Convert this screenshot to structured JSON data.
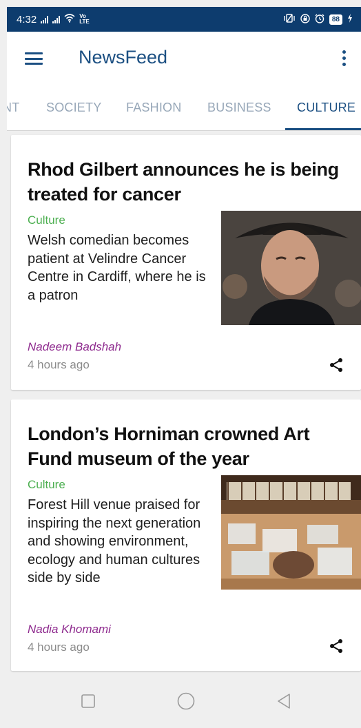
{
  "status_bar": {
    "time": "4:32",
    "volte": "Vo\nLTE",
    "battery": "88",
    "icons": [
      "signal-icon",
      "signal-icon",
      "wifi-icon",
      "volte-icon",
      "vibrate-icon",
      "lock-rotation-icon",
      "alarm-icon",
      "battery-icon",
      "charging-icon"
    ]
  },
  "app_bar": {
    "title": "NewsFeed",
    "menu_icon": "hamburger-menu-icon",
    "overflow_icon": "more-vertical-icon"
  },
  "tabs": [
    {
      "label": "NT",
      "active": false
    },
    {
      "label": "SOCIETY",
      "active": false
    },
    {
      "label": "FASHION",
      "active": false
    },
    {
      "label": "BUSINESS",
      "active": false
    },
    {
      "label": "CULTURE",
      "active": true
    }
  ],
  "colors": {
    "primary": "#1b4f82",
    "status_bar": "#0d3c6e",
    "category": "#4caf50",
    "author": "#8e2a8e",
    "inactive_tab": "#97a7b8"
  },
  "articles": [
    {
      "title": "Rhod Gilbert announces he is being treated for cancer",
      "category": "Culture",
      "summary": "Welsh comedian becomes patient at Velindre Cancer Centre in Cardiff, where he is a patron",
      "author": "Nadeem Badshah",
      "time": "4 hours ago",
      "image": "portrait-photo"
    },
    {
      "title": "London’s Horniman crowned Art Fund museum of the year",
      "category": "Culture",
      "summary": "Forest Hill venue praised for inspiring the next generation and showing environment, ecology and human cultures side by side",
      "author": "Nadia Khomami",
      "time": "4 hours ago",
      "image": "museum-hall-photo"
    }
  ],
  "nav_bar": {
    "buttons": [
      "recents-square-icon",
      "home-circle-icon",
      "back-triangle-icon"
    ]
  }
}
